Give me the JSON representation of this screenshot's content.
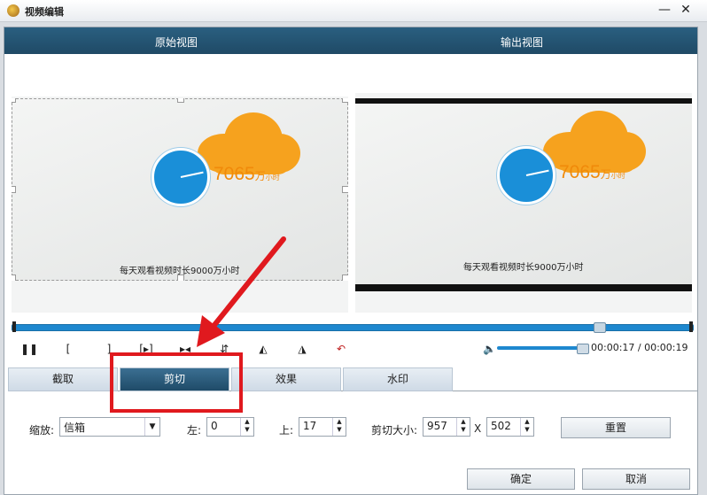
{
  "window": {
    "title": "视频编辑"
  },
  "views": {
    "original": "原始视图",
    "output": "输出视图"
  },
  "preview": {
    "number": "7065",
    "unit_wan": "万",
    "unit_hours": "小时",
    "caption": "每天观看视频时长9000万小时"
  },
  "player": {
    "time": "00:00:17 / 00:00:19",
    "progress": 0.89,
    "volume": 0.9
  },
  "tabs": [
    {
      "label": "截取"
    },
    {
      "label": "剪切"
    },
    {
      "label": "效果"
    },
    {
      "label": "水印"
    }
  ],
  "crop": {
    "zoom_label": "缩放:",
    "zoom_value": "信箱",
    "left_label": "左:",
    "left_value": "0",
    "top_label": "上:",
    "top_value": "17",
    "size_label": "剪切大小:",
    "width_value": "957",
    "x_sep": "X",
    "height_value": "502",
    "reset_label": "重置"
  },
  "footer": {
    "ok": "确定",
    "cancel": "取消"
  },
  "colors": {
    "accent": "#1e88cf",
    "header": "#1f4a66",
    "annotation": "#e0191e",
    "orange": "#f6a21e"
  }
}
